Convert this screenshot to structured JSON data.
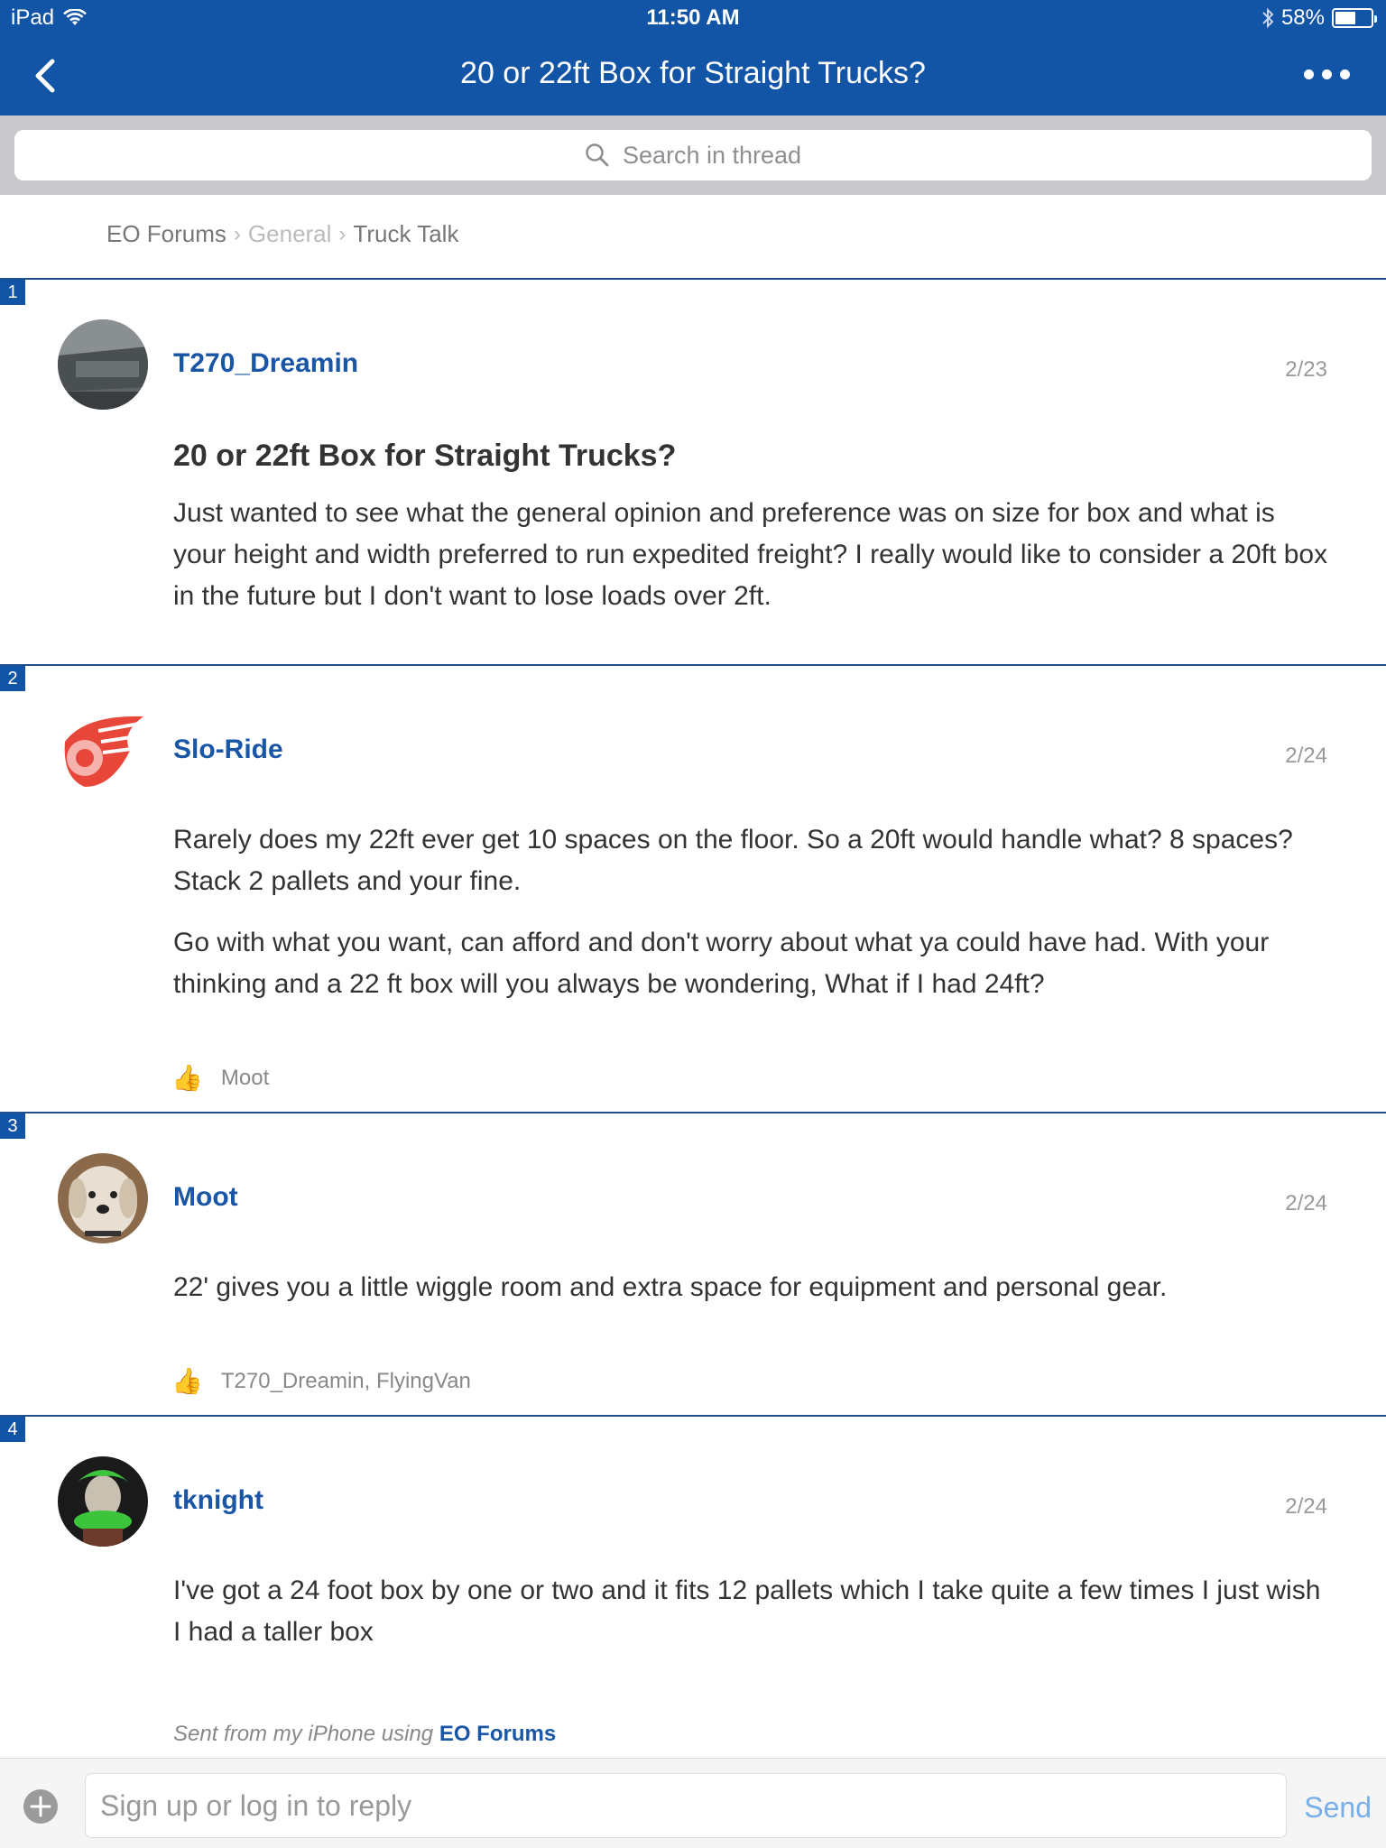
{
  "status": {
    "device": "iPad",
    "time": "11:50 AM",
    "battery": "58%",
    "battery_level": 0.58
  },
  "nav": {
    "title": "20 or 22ft Box for Straight Trucks?"
  },
  "search": {
    "placeholder": "Search in thread"
  },
  "breadcrumb": [
    {
      "label": "EO Forums"
    },
    {
      "label": "General"
    },
    {
      "label": "Truck Talk"
    }
  ],
  "posts": [
    {
      "number": "1",
      "user": "T270_Dreamin",
      "date": "2/23",
      "title": "20 or 22ft Box for Straight Trucks?",
      "paragraphs": [
        "Just wanted to see what the general opinion and preference was on size for box and what is your height and width preferred to run expedited freight? I really would like to consider a 20ft box in the future but I don't want to lose loads over 2ft."
      ]
    },
    {
      "number": "2",
      "user": "Slo-Ride",
      "date": "2/24",
      "paragraphs": [
        "Rarely does my 22ft ever get 10 spaces on the floor. So a 20ft would handle what? 8 spaces? Stack 2 pallets and your fine.",
        "Go with what you want, can afford and don't worry about what ya could have had. With your thinking and a 22 ft box will you always be wondering, What if I had 24ft?"
      ],
      "likes": "Moot"
    },
    {
      "number": "3",
      "user": "Moot",
      "date": "2/24",
      "paragraphs": [
        "22' gives you a little wiggle room and extra space for equipment and personal gear."
      ],
      "likes": "T270_Dreamin, FlyingVan"
    },
    {
      "number": "4",
      "user": "tknight",
      "date": "2/24",
      "paragraphs": [
        "I've got a 24 foot box by one or two and it fits 12 pallets which I take quite a few times I just wish I had a taller box"
      ],
      "signature": {
        "prefix": "Sent from my iPhone using",
        "app": "EO Forums"
      }
    }
  ],
  "reply": {
    "placeholder": "Sign up or log in to reply",
    "send_label": "Send"
  },
  "icons": {
    "back": "chevron-left-icon",
    "more": "ellipsis-icon",
    "search": "search-icon",
    "like": "thumbs-up-icon",
    "add": "plus-icon",
    "wifi": "wifi-icon",
    "bluetooth": "bluetooth-icon",
    "battery": "battery-icon"
  },
  "colors": {
    "nav": "#1254a6",
    "link": "#1a56a6",
    "send": "#7aaee8"
  }
}
